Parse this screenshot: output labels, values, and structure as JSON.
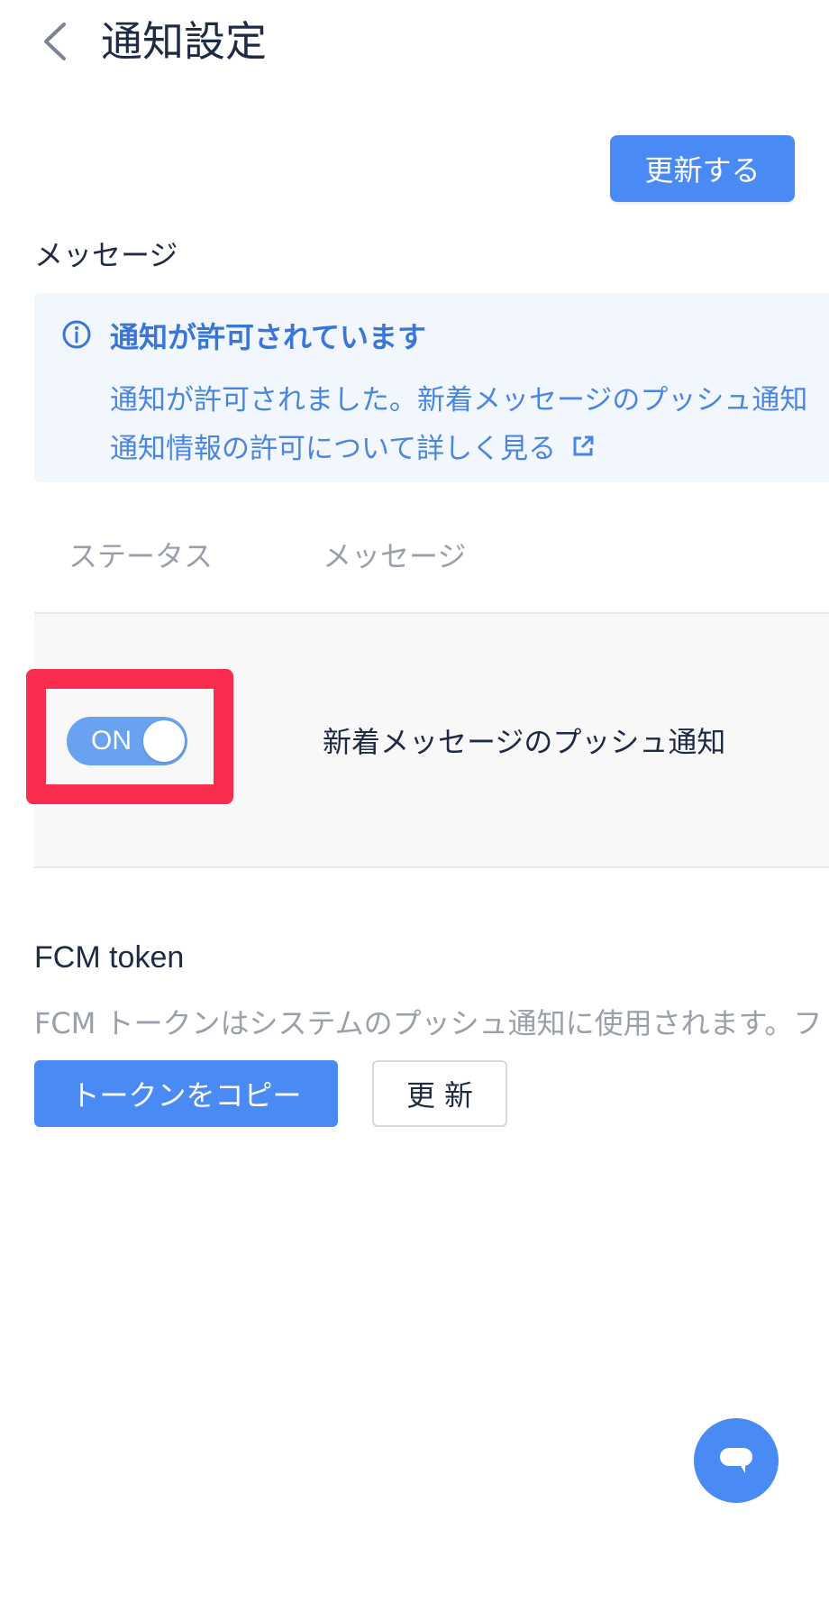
{
  "header": {
    "title": "通知設定"
  },
  "toolbar": {
    "update_label": "更新する"
  },
  "section": {
    "label": "メッセージ"
  },
  "info": {
    "title": "通知が許可されています",
    "line1": "通知が許可されました。新着メッセージのプッシュ通知",
    "link": "通知情報の許可について詳しく見る"
  },
  "table": {
    "columns": [
      "ステータス",
      "メッセージ"
    ],
    "rows": [
      {
        "toggle_label": "ON",
        "toggle_on": true,
        "message": "新着メッセージのプッシュ通知"
      }
    ]
  },
  "fcm": {
    "title": "FCM token",
    "description": "FCM トークンはシステムのプッシュ通知に使用されます。フ",
    "copy_label": "トークンをコピー",
    "refresh_label": "更新"
  },
  "colors": {
    "accent": "#4a8af4",
    "highlight": "#fb2d4e",
    "toggle": "#6aa2f2",
    "info_bg": "#f2f7fd"
  },
  "icons": {
    "back": "chevron-left-icon",
    "info": "info-circle-icon",
    "external": "external-link-icon",
    "chat": "chat-bubble-icon"
  }
}
